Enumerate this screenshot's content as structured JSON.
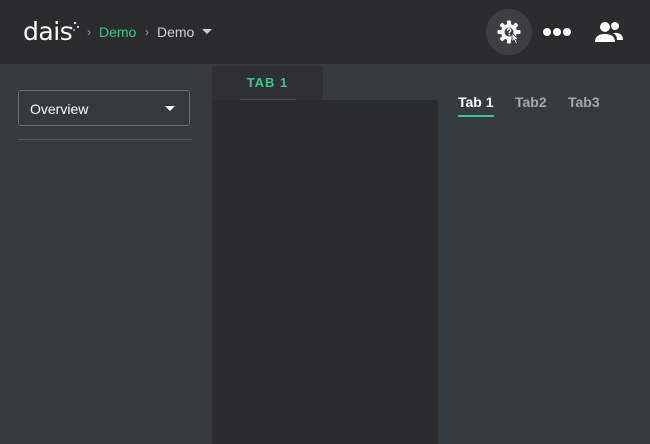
{
  "app": {
    "logo_text": "dais"
  },
  "breadcrumb": {
    "items": [
      "Demo",
      "Demo"
    ]
  },
  "header": {
    "settings_icon": "gear-help-icon",
    "more_icon": "more-dots-icon",
    "users_icon": "users-icon"
  },
  "sidebar": {
    "dropdown_value": "Overview"
  },
  "panel": {
    "tab_label": "TAB 1"
  },
  "tabs": [
    "Tab 1",
    "Tab2",
    "Tab3"
  ],
  "colors": {
    "accent": "#3ec48c",
    "topbar": "#2b2c2e",
    "background": "#363b3f"
  }
}
